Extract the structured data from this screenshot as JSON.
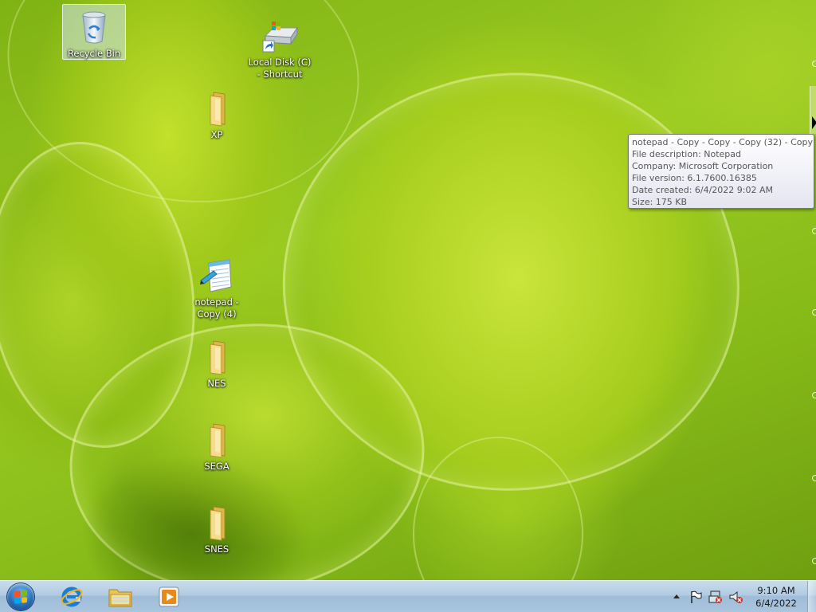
{
  "desktop": {
    "icons": [
      {
        "id": "recycle-bin",
        "label": "Recycle Bin",
        "icon": "recycle-bin-icon"
      },
      {
        "id": "local-disk",
        "label": "Local Disk (C)\n- Shortcut",
        "icon": "drive-shortcut-icon"
      },
      {
        "id": "xp",
        "label": "XP",
        "icon": "folder-icon"
      },
      {
        "id": "notepad-copy",
        "label": "notepad -\nCopy (4)",
        "icon": "notepad-icon"
      },
      {
        "id": "nes",
        "label": "NES",
        "icon": "folder-icon"
      },
      {
        "id": "sega",
        "label": "SEGA",
        "icon": "folder-icon"
      },
      {
        "id": "snes",
        "label": "SNES",
        "icon": "folder-icon"
      }
    ]
  },
  "tooltip": {
    "name": "notepad - Copy - Copy - Copy (32) - Copy",
    "description": "File description: Notepad",
    "company": "Company: Microsoft Corporation",
    "version": "File version: 6.1.7600.16385",
    "created": "Date created: 6/4/2022 9:02 AM",
    "size": "Size: 175 KB"
  },
  "taskbar": {
    "start": "start-orb-icon",
    "pinned": [
      "internet-explorer-icon",
      "windows-explorer-icon",
      "media-player-icon"
    ],
    "tray": [
      "show-hidden-icons",
      "action-center-flag-icon",
      "network-icon",
      "volume-muted-icon"
    ],
    "time": "9:10 AM",
    "date": "6/4/2022"
  },
  "colors": {
    "wallpaper": "#8fbf1a",
    "taskbar": "#b2cbe2",
    "tooltip_text": "#575757"
  }
}
